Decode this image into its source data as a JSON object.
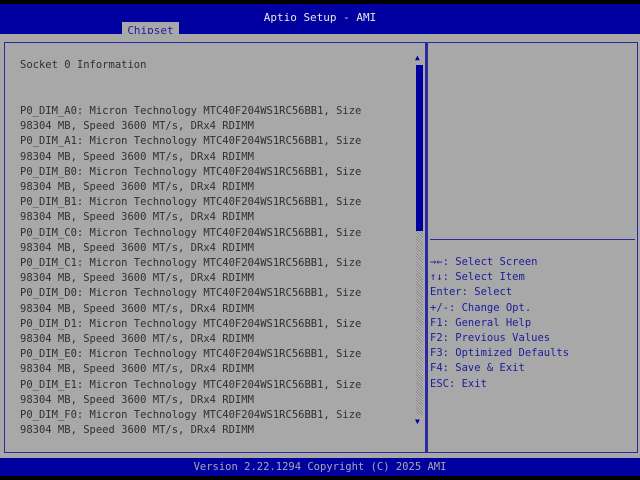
{
  "header": {
    "title": "Aptio Setup - AMI",
    "tab": "Chipset"
  },
  "main": {
    "heading": "Socket 0 Information",
    "lines": [
      "P0_DIM_A0: Micron Technology MTC40F204WS1RC56BB1, Size",
      "98304 MB, Speed 3600 MT/s, DRx4 RDIMM",
      "P0_DIM_A1: Micron Technology MTC40F204WS1RC56BB1, Size",
      "98304 MB, Speed 3600 MT/s, DRx4 RDIMM",
      "P0_DIM_B0: Micron Technology MTC40F204WS1RC56BB1, Size",
      "98304 MB, Speed 3600 MT/s, DRx4 RDIMM",
      "P0_DIM_B1: Micron Technology MTC40F204WS1RC56BB1, Size",
      "98304 MB, Speed 3600 MT/s, DRx4 RDIMM",
      "P0_DIM_C0: Micron Technology MTC40F204WS1RC56BB1, Size",
      "98304 MB, Speed 3600 MT/s, DRx4 RDIMM",
      "P0_DIM_C1: Micron Technology MTC40F204WS1RC56BB1, Size",
      "98304 MB, Speed 3600 MT/s, DRx4 RDIMM",
      "P0_DIM_D0: Micron Technology MTC40F204WS1RC56BB1, Size",
      "98304 MB, Speed 3600 MT/s, DRx4 RDIMM",
      "P0_DIM_D1: Micron Technology MTC40F204WS1RC56BB1, Size",
      "98304 MB, Speed 3600 MT/s, DRx4 RDIMM",
      "P0_DIM_E0: Micron Technology MTC40F204WS1RC56BB1, Size",
      "98304 MB, Speed 3600 MT/s, DRx4 RDIMM",
      "P0_DIM_E1: Micron Technology MTC40F204WS1RC56BB1, Size",
      "98304 MB, Speed 3600 MT/s, DRx4 RDIMM",
      "P0_DIM_F0: Micron Technology MTC40F204WS1RC56BB1, Size",
      "98304 MB, Speed 3600 MT/s, DRx4 RDIMM"
    ],
    "scroll_up": "▲",
    "scroll_down": "▼"
  },
  "help": [
    "→←: Select Screen",
    "↑↓: Select Item",
    "Enter: Select",
    "+/-: Change Opt.",
    "F1: General Help",
    "F2: Previous Values",
    "F3: Optimized Defaults",
    "F4: Save & Exit",
    "ESC: Exit"
  ],
  "footer": "Version 2.22.1294 Copyright (C) 2025 AMI"
}
